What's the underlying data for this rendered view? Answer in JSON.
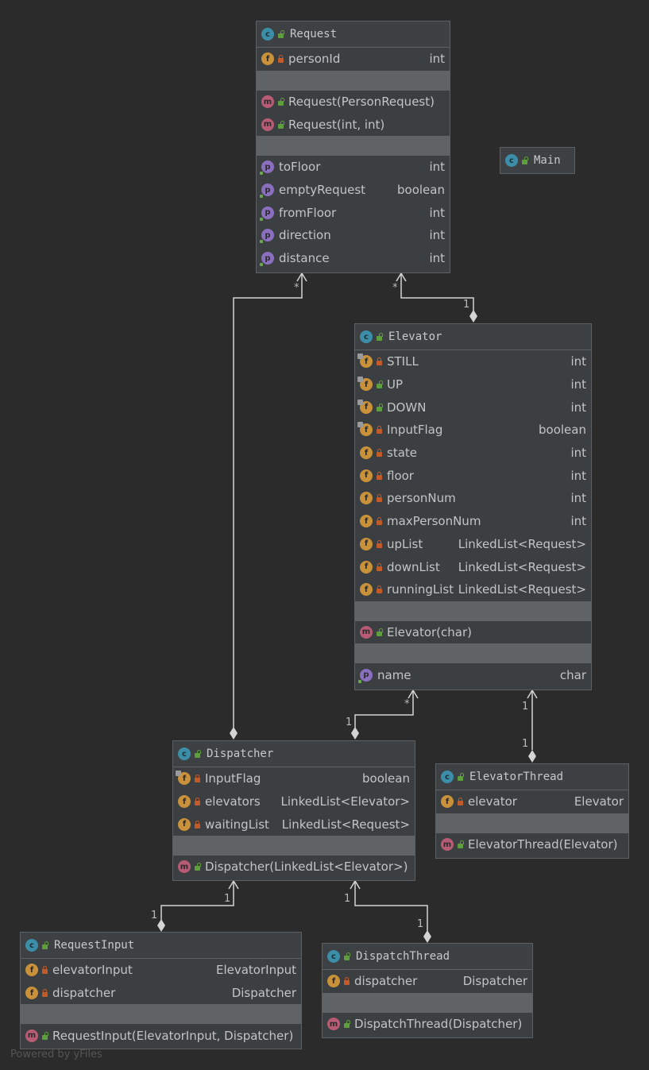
{
  "classes": {
    "request": {
      "name": "Request",
      "fields": [
        {
          "name": "personId",
          "type": "int"
        }
      ],
      "methods": [
        {
          "name": "Request(PersonRequest)"
        },
        {
          "name": "Request(int, int)"
        }
      ],
      "properties": [
        {
          "name": "toFloor",
          "type": "int"
        },
        {
          "name": "emptyRequest",
          "type": "boolean"
        },
        {
          "name": "fromFloor",
          "type": "int"
        },
        {
          "name": "direction",
          "type": "int"
        },
        {
          "name": "distance",
          "type": "int"
        }
      ]
    },
    "main": {
      "name": "Main"
    },
    "elevator": {
      "name": "Elevator",
      "fields": [
        {
          "name": "STILL",
          "type": "int"
        },
        {
          "name": "UP",
          "type": "int"
        },
        {
          "name": "DOWN",
          "type": "int"
        },
        {
          "name": "InputFlag",
          "type": "boolean"
        },
        {
          "name": "state",
          "type": "int"
        },
        {
          "name": "floor",
          "type": "int"
        },
        {
          "name": "personNum",
          "type": "int"
        },
        {
          "name": "maxPersonNum",
          "type": "int"
        },
        {
          "name": "upList",
          "type": "LinkedList<Request>"
        },
        {
          "name": "downList",
          "type": "LinkedList<Request>"
        },
        {
          "name": "runningList",
          "type": "LinkedList<Request>"
        }
      ],
      "methods": [
        {
          "name": "Elevator(char)"
        }
      ],
      "properties": [
        {
          "name": "name",
          "type": "char"
        }
      ]
    },
    "dispatcher": {
      "name": "Dispatcher",
      "fields": [
        {
          "name": "InputFlag",
          "type": "boolean"
        },
        {
          "name": "elevators",
          "type": "LinkedList<Elevator>"
        },
        {
          "name": "waitingList",
          "type": "LinkedList<Request>"
        }
      ],
      "methods": [
        {
          "name": "Dispatcher(LinkedList<Elevator>)"
        }
      ]
    },
    "elevatorThread": {
      "name": "ElevatorThread",
      "fields": [
        {
          "name": "elevator",
          "type": "Elevator"
        }
      ],
      "methods": [
        {
          "name": "ElevatorThread(Elevator)"
        }
      ]
    },
    "requestInput": {
      "name": "RequestInput",
      "fields": [
        {
          "name": "elevatorInput",
          "type": "ElevatorInput"
        },
        {
          "name": "dispatcher",
          "type": "Dispatcher"
        }
      ],
      "methods": [
        {
          "name": "RequestInput(ElevatorInput, Dispatcher)"
        }
      ]
    },
    "dispatchThread": {
      "name": "DispatchThread",
      "fields": [
        {
          "name": "dispatcher",
          "type": "Dispatcher"
        }
      ],
      "methods": [
        {
          "name": "DispatchThread(Dispatcher)"
        }
      ]
    }
  },
  "icons": {
    "class": "class-icon",
    "field": "field-icon",
    "method": "method-icon",
    "property": "property-icon",
    "public": "public-lock-icon",
    "private": "private-lock-icon"
  },
  "colors": {
    "background": "#2b2b2b",
    "node": "#3c3f41",
    "separator": "#5f6366",
    "class_icon": "#3c8ea8",
    "field_icon": "#c9913a",
    "method_icon": "#b85b74",
    "property_icon": "#8a6fbf",
    "edge": "#d4d4d4"
  },
  "multiplicities": {
    "m1": "*",
    "m2": "*",
    "m3": "1",
    "m4": "*",
    "m5": "1",
    "m6": "1",
    "m7": "1",
    "m8": "1",
    "m9": "1",
    "m10": "1",
    "m11": "1"
  },
  "footer": "Powered by yFiles"
}
